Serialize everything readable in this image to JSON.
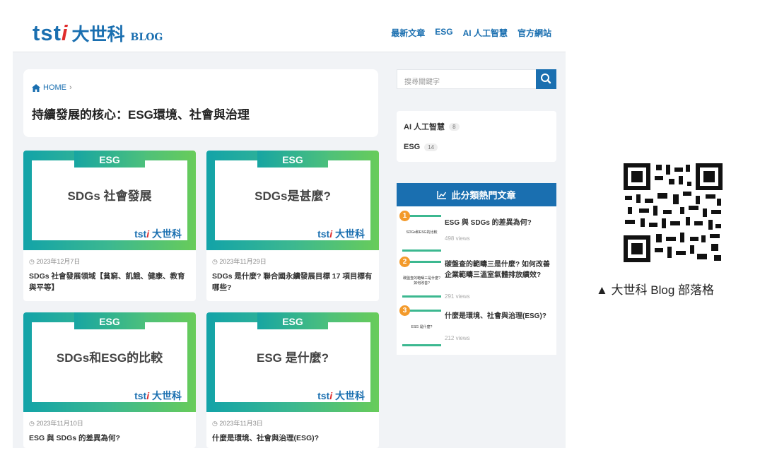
{
  "header": {
    "logo_latin": "tst",
    "logo_i": "i",
    "logo_cn": "大世科",
    "logo_blog": "BLOG",
    "nav": [
      "最新文章",
      "ESG",
      "AI 人工智慧",
      "官方網站"
    ]
  },
  "breadcrumb": {
    "home": "HOME",
    "sep": "›"
  },
  "page_title": "持續發展的核心：ESG環境、社會與治理",
  "cards": [
    {
      "tag": "ESG",
      "thumb_title": "SDGs 社會發展",
      "brand_latin": "tst",
      "brand_i": "i",
      "brand_cn": "大世科",
      "date": "2023年12月7日",
      "title": "SDGs 社會發展領域【貧窮、飢餓、健康、教育與平等】"
    },
    {
      "tag": "ESG",
      "thumb_title": "SDGs是甚麼?",
      "brand_latin": "tst",
      "brand_i": "i",
      "brand_cn": "大世科",
      "date": "2023年11月29日",
      "title": "SDGs 是什麼? 聯合國永續發展目標 17 項目標有哪些?"
    },
    {
      "tag": "ESG",
      "thumb_title": "SDGs和ESG的比較",
      "brand_latin": "tst",
      "brand_i": "i",
      "brand_cn": "大世科",
      "date": "2023年11月10日",
      "title": "ESG 與 SDGs 的差異為何?"
    },
    {
      "tag": "ESG",
      "thumb_title": "ESG  是什麼?",
      "brand_latin": "tst",
      "brand_i": "i",
      "brand_cn": "大世科",
      "date": "2023年11月3日",
      "title": "什麼是環境、社會與治理(ESG)?"
    }
  ],
  "sidebar": {
    "search_placeholder": "搜尋關鍵字",
    "categories": [
      {
        "name": "AI 人工智慧",
        "count": "8"
      },
      {
        "name": "ESG",
        "count": "14"
      }
    ],
    "popular_heading": "此分類熱門文章",
    "popular": [
      {
        "rank": "1",
        "thumb_text": "SDGs和ESG的比較",
        "title": "ESG 與 SDGs 的差異為何?",
        "views": "498 views"
      },
      {
        "rank": "2",
        "thumb_text": "碳盤查的範疇三是什麼?如何改善?",
        "title": "碳盤查的範疇三是什麼? 如何改善企業範疇三溫室氣體排放績效?",
        "views": "291 views"
      },
      {
        "rank": "3",
        "thumb_text": "ESG 是什麼?",
        "title": "什麼是環境、社會與治理(ESG)?",
        "views": "212 views"
      }
    ]
  },
  "qr_caption": "▲ 大世科 Blog 部落格",
  "colors": {
    "brand_blue": "#1a6fb0",
    "brand_red": "#e02b2b",
    "green_start": "#12a3a8",
    "green_end": "#68cc5a",
    "rank_orange": "#f39a2b"
  }
}
